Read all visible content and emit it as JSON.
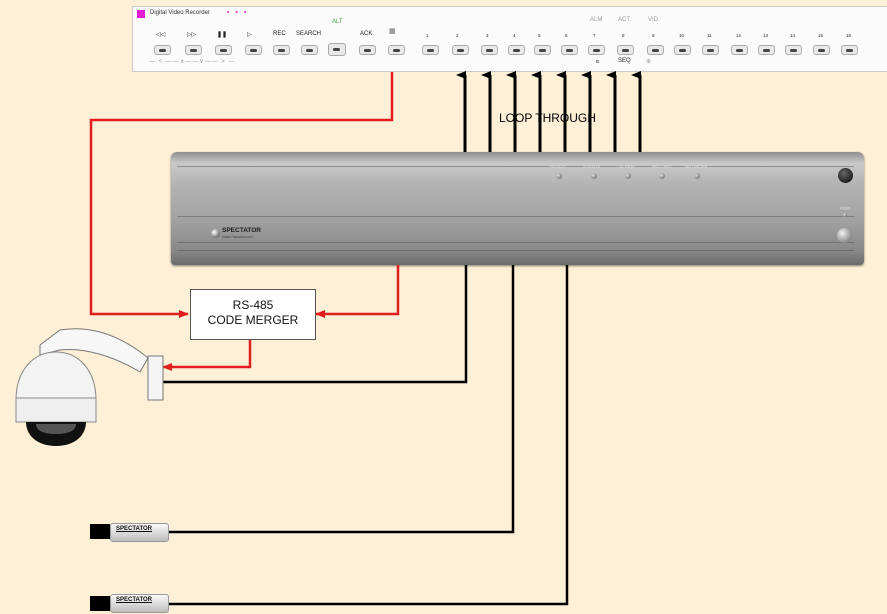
{
  "panel": {
    "title": "Digital Video Recorder",
    "badge_color": "#e21fd5",
    "dots": "▪ ▪ ▪",
    "transport": [
      "◁◁",
      "▷▷",
      "❚❚",
      "▷"
    ],
    "rec": "REC",
    "search": "SEARCH",
    "alt": "ALT",
    "ack": "ACK",
    "status_labels": [
      "ALM",
      "ACT",
      "VID"
    ],
    "channels": [
      "1",
      "2",
      "3",
      "4",
      "5",
      "6",
      "7",
      "8",
      "9",
      "10",
      "11",
      "12",
      "13",
      "14",
      "15",
      "16"
    ],
    "seq": "SEQ",
    "b_label": "B"
  },
  "dvr": {
    "leds": [
      "READY",
      "STATUS",
      "ALARM",
      "RECORD",
      "NETWORK"
    ],
    "brand": "SPECTATOR",
    "brand_sub": "VIDEO TECHNOLOGY",
    "pwr": "PWR"
  },
  "merger": {
    "line1": "RS-485",
    "line2": "CODE MERGER"
  },
  "loop_through": "LOOP THROUGH",
  "cameras": [
    "SPECTATOR",
    "SPECTATOR"
  ],
  "colors": {
    "rs485": "#e21d1d",
    "video": "#000000",
    "background": "#fdf0d6"
  }
}
